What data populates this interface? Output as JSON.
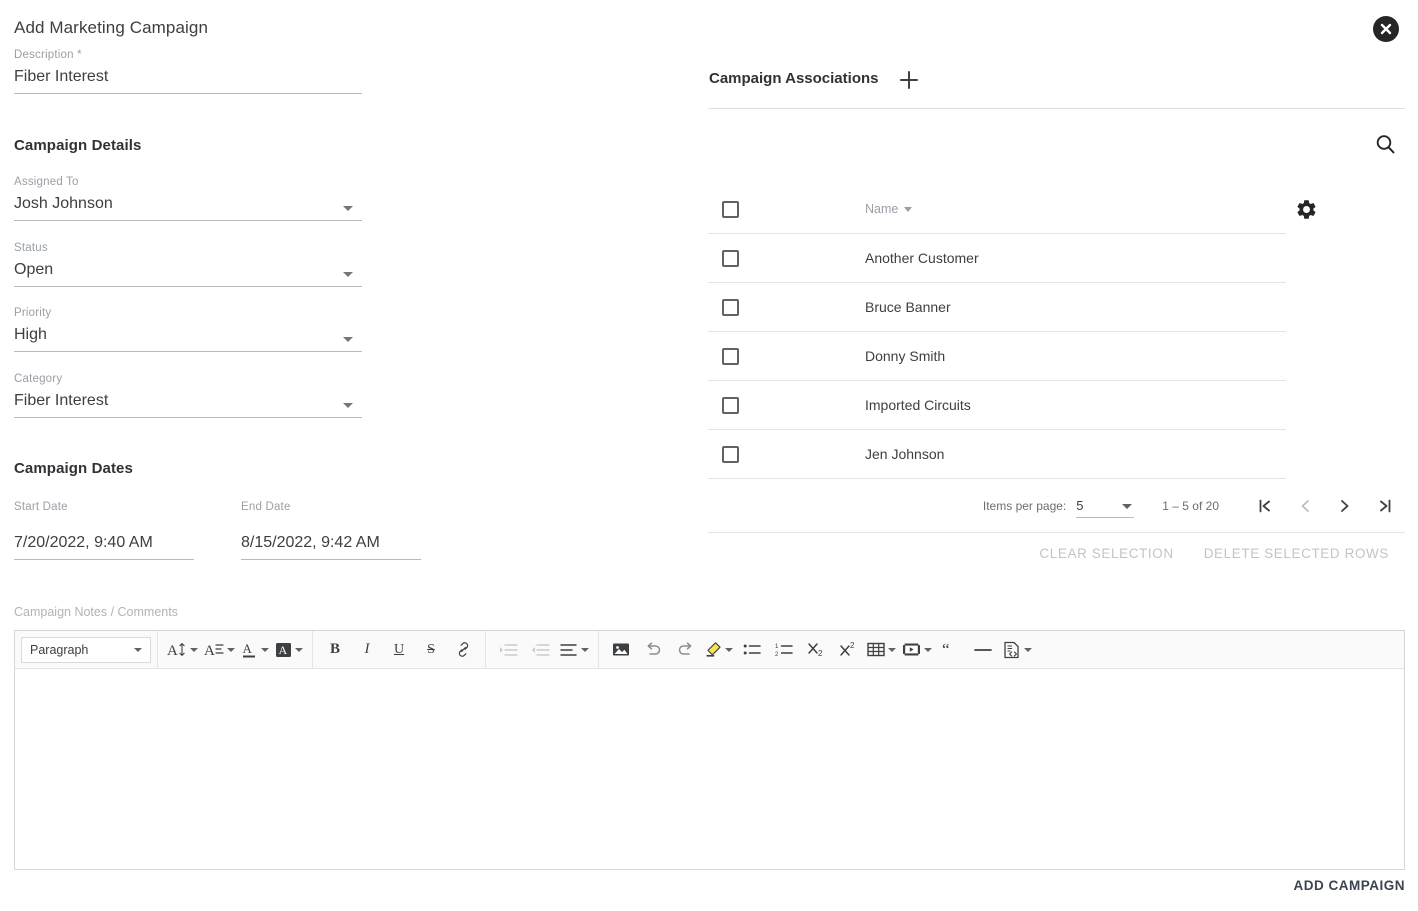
{
  "dialog": {
    "title": "Add Marketing Campaign",
    "close_icon": "close-circle-icon"
  },
  "description": {
    "label": "Description *",
    "value": "Fiber Interest"
  },
  "campaign_details": {
    "heading": "Campaign Details",
    "fields": [
      {
        "label": "Assigned To",
        "value": "Josh Johnson",
        "icon": "dropdown-caret-icon"
      },
      {
        "label": "Status",
        "value": "Open",
        "icon": "dropdown-caret-icon"
      },
      {
        "label": "Priority",
        "value": "High",
        "icon": "dropdown-caret-icon"
      },
      {
        "label": "Category",
        "value": "Fiber Interest",
        "icon": "dropdown-caret-icon"
      }
    ]
  },
  "campaign_dates": {
    "heading": "Campaign Dates",
    "start": {
      "label": "Start Date",
      "value": "7/20/2022, 9:40 AM"
    },
    "end": {
      "label": "End Date",
      "value": "8/15/2022, 9:42 AM"
    }
  },
  "associations": {
    "title": "Campaign Associations",
    "add_icon": "plus-icon",
    "search_icon": "search-icon",
    "settings_icon": "gear-icon",
    "columns": {
      "name": "Name"
    },
    "sort_icon": "sort-descending-caret-icon",
    "rows": [
      {
        "name": "Another Customer",
        "checked": false
      },
      {
        "name": "Bruce Banner",
        "checked": false
      },
      {
        "name": "Donny Smith",
        "checked": false
      },
      {
        "name": "Imported Circuits",
        "checked": false
      },
      {
        "name": "Jen Johnson",
        "checked": false
      }
    ],
    "paginator": {
      "items_per_page_label": "Items per page:",
      "items_per_page_value": "5",
      "range_label": "1 – 5 of 20",
      "first_icon": "first-page-icon",
      "prev_icon": "previous-page-icon",
      "next_icon": "next-page-icon",
      "last_icon": "last-page-icon"
    },
    "clear_selection_label": "CLEAR SELECTION",
    "delete_selected_label": "DELETE SELECTED ROWS"
  },
  "notes": {
    "label": "Campaign Notes / Comments",
    "body_value": "",
    "toolbar": {
      "paragraph_label": "Paragraph",
      "font_size": "font-size-icon",
      "line_height": "line-height-icon",
      "font_color": "font-color-icon",
      "background_color": "background-color-icon",
      "bold": "bold-icon",
      "italic": "italic-icon",
      "underline": "underline-icon",
      "strikethrough": "strikethrough-icon",
      "link": "link-icon",
      "indent": "indent-icon",
      "outdent": "outdent-icon",
      "align": "align-icon",
      "image": "image-icon",
      "undo": "undo-icon",
      "redo": "redo-icon",
      "highlight": "highlight-marker-icon",
      "bullet_list": "bullet-list-icon",
      "numbered_list": "numbered-list-icon",
      "subscript": "subscript-icon",
      "superscript": "superscript-icon",
      "table": "table-icon",
      "video": "video-icon",
      "blockquote": "blockquote-icon",
      "horizontal_rule": "horizontal-rule-icon",
      "source_code": "source-code-icon"
    }
  },
  "footer": {
    "add_campaign_label": "ADD CAMPAIGN"
  },
  "colors": {
    "text": "#3c4043",
    "muted": "#9aa0a6",
    "divider": "#e0e0e0",
    "accent_dark": "#262626",
    "disabled": "#c4c4c4",
    "highlight_yellow": "#f5e642"
  }
}
